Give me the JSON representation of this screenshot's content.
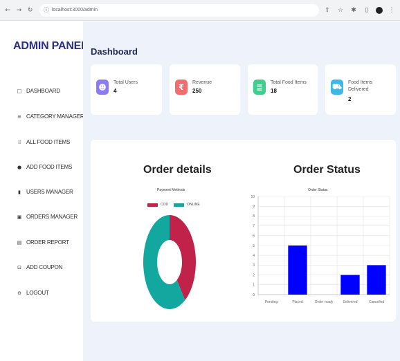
{
  "browser": {
    "url": "localhost:3000/admin"
  },
  "sidebar": {
    "brand": "ADMIN PANEL",
    "items": [
      {
        "label": "DASHBOARD",
        "icon": "square-icon"
      },
      {
        "label": "CATEGORY MANAGER",
        "icon": "list-icon"
      },
      {
        "label": "ALL FOOD ITEMS",
        "icon": "grid-icon"
      },
      {
        "label": "ADD FOOD ITEMS",
        "icon": "plus-bag-icon"
      },
      {
        "label": "USERS MANAGER",
        "icon": "user-icon"
      },
      {
        "label": "ORDERS MANAGER",
        "icon": "box-icon"
      },
      {
        "label": "ORDER REPORT",
        "icon": "report-icon"
      },
      {
        "label": "ADD COUPON",
        "icon": "coupon-icon"
      },
      {
        "label": "LOGOUT",
        "icon": "logout-icon"
      }
    ]
  },
  "main": {
    "title": "Dashboard",
    "cards": [
      {
        "label": "Total Users",
        "value": "4",
        "color": "#8b7cf6",
        "icon": "users-icon"
      },
      {
        "label": "Revenue",
        "value": "250",
        "color": "#f26d6d",
        "icon": "rupee-icon"
      },
      {
        "label": "Total Food Items",
        "value": "18",
        "color": "#3ecf8e",
        "icon": "burger-icon"
      },
      {
        "label": "Food Items Delivered",
        "value": "2",
        "color": "#3bb8e8",
        "icon": "truck-icon"
      }
    ],
    "order_details_title": "Order details",
    "order_status_title": "Order Status"
  },
  "chart_data": [
    {
      "type": "pie",
      "title": "Payment Methods",
      "categories": [
        "COD",
        "ONLINE"
      ],
      "values": [
        2,
        3
      ],
      "colors": [
        "#c0224a",
        "#12a8a0"
      ],
      "legend": "top"
    },
    {
      "type": "bar",
      "title": "Order Status",
      "categories": [
        "Pending",
        "Placed",
        "Order ready",
        "Delivered",
        "Cancelled"
      ],
      "values": [
        0,
        5,
        0,
        2,
        3
      ],
      "ylim": [
        0,
        10
      ],
      "yticks": [
        "0",
        "1",
        "2",
        "3",
        "4",
        "5",
        "6",
        "7",
        "8",
        "9",
        "10"
      ],
      "color": "#0000ff",
      "grid": true
    }
  ]
}
